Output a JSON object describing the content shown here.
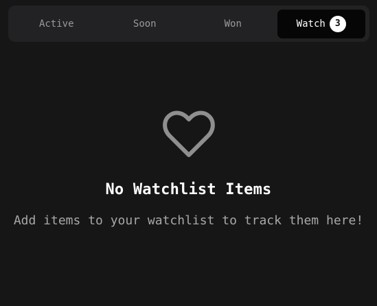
{
  "tabs": [
    {
      "label": "Active"
    },
    {
      "label": "Soon"
    },
    {
      "label": "Won"
    },
    {
      "label": "Watch",
      "badge": "3",
      "selected": true
    }
  ],
  "empty_state": {
    "icon": "heart-icon",
    "title": "No Watchlist Items",
    "description": "Add items to your watchlist to track them here!"
  },
  "colors": {
    "background": "#161616",
    "tabbar": "#222224",
    "active_tab": "#060606",
    "muted_text": "#9a9a9a",
    "icon": "#8f8f8f"
  }
}
